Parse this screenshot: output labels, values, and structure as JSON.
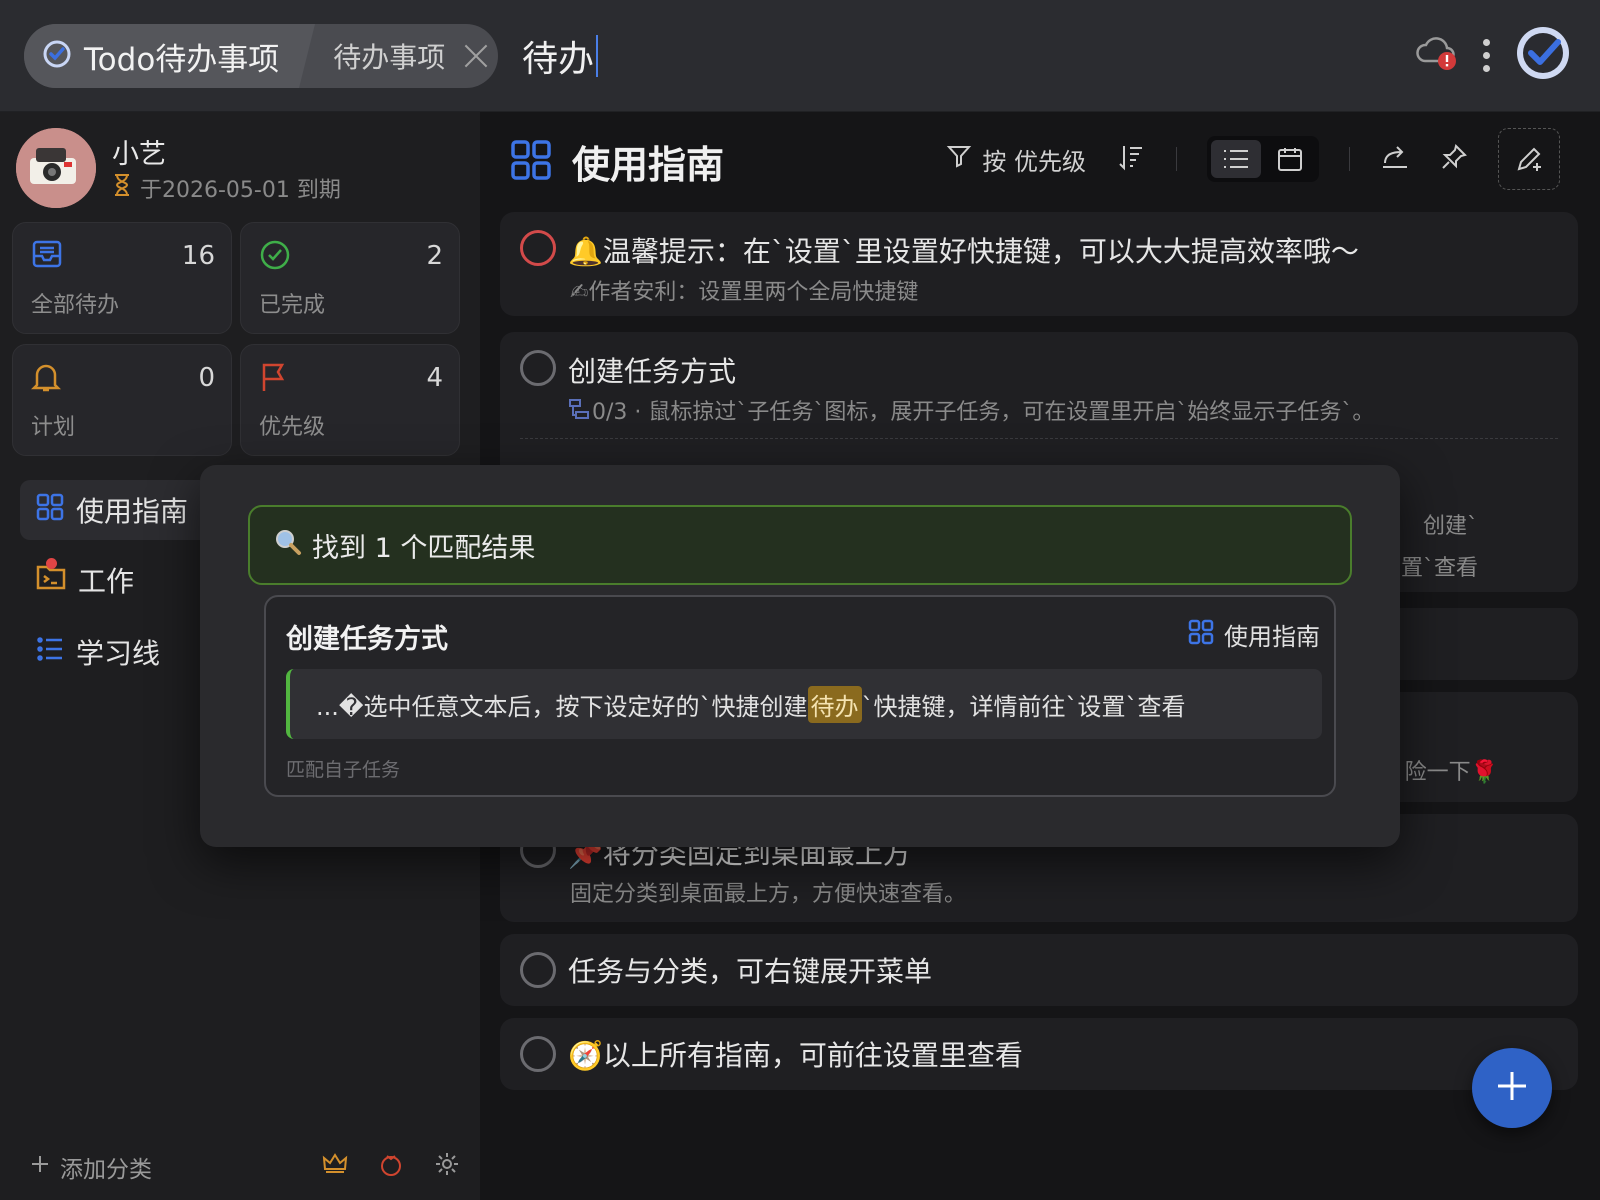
{
  "topbar": {
    "app_title": "Todo待办事项",
    "tab_label": "待办事项",
    "search_query": "待办"
  },
  "sidebar": {
    "user_name": "小艺",
    "expiry": "于2026-05-01 到期",
    "stats": [
      {
        "label": "全部待办",
        "count": "16"
      },
      {
        "label": "已完成",
        "count": "2"
      },
      {
        "label": "计划",
        "count": "0"
      },
      {
        "label": "优先级",
        "count": "4"
      }
    ],
    "categories": [
      {
        "label": "使用指南"
      },
      {
        "label": "工作"
      },
      {
        "label": "学习线"
      }
    ],
    "add_category": "添加分类"
  },
  "main": {
    "title": "使用指南",
    "filter_label": "按 优先级",
    "tasks": [
      {
        "title": "🔔温馨提示：在`设置`里设置好快捷键，可以大大提高效率哦～",
        "sub": "✍作者安利：设置里两个全局快捷键"
      },
      {
        "title": "创建任务方式",
        "sub": "0/3 · 鼠标掠过`子任务`图标，展开子任务，可在设置里开启`始终显示子任务`。",
        "edge1": "创建`",
        "edge2": "置`查看"
      },
      {
        "edge": "险一下🌹"
      },
      {
        "title": "📌将分类固定到桌面最上方",
        "sub": "固定分类到桌面最上方，方便快速查看。"
      },
      {
        "title": "任务与分类，可右键展开菜单"
      },
      {
        "title": "🧭以上所有指南，可前往设置里查看"
      }
    ]
  },
  "popup": {
    "found_text": "找到 1 个匹配结果",
    "result_title": "创建任务方式",
    "result_category": "使用指南",
    "snippet_before": "...�选中任意文本后，按下设定好的`快捷创建",
    "snippet_match": "待办",
    "snippet_after": "`快捷键，详情前往`设置`查看",
    "match_source": "匹配自子任务"
  }
}
